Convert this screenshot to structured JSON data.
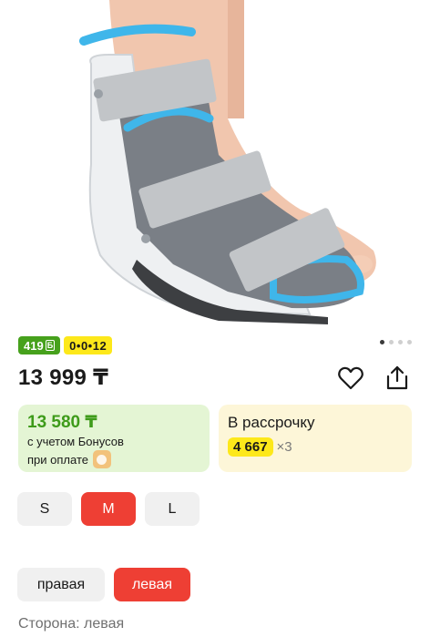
{
  "product_image": {
    "alt_icon": "orthopedic-walker-boot-photo"
  },
  "badges": {
    "bonus_points": "419",
    "bonus_symbol": "Б",
    "installment_plan": "0•0•12"
  },
  "gallery": {
    "dots_total": 4,
    "active_index": 0
  },
  "price": {
    "main": "13 999 ₸"
  },
  "actions": {
    "favorite_icon": "heart-icon",
    "share_icon": "share-icon"
  },
  "bonus_card": {
    "price": "13 580 ₸",
    "line1": "с учетом Бонусов",
    "line2": "при оплате"
  },
  "installment_card": {
    "title": "В рассрочку",
    "amount": "4 667",
    "multiplier": "×3"
  },
  "sizes": {
    "options": [
      "S",
      "M",
      "L"
    ],
    "selected": "M"
  },
  "sides": {
    "options": [
      "правая",
      "левая"
    ],
    "selected": "левая"
  },
  "side_label": "Сторона: левая",
  "colors": {
    "accent_red": "#ee3f34",
    "bonus_green": "#46a11c",
    "installment_yellow": "#fde81a"
  }
}
